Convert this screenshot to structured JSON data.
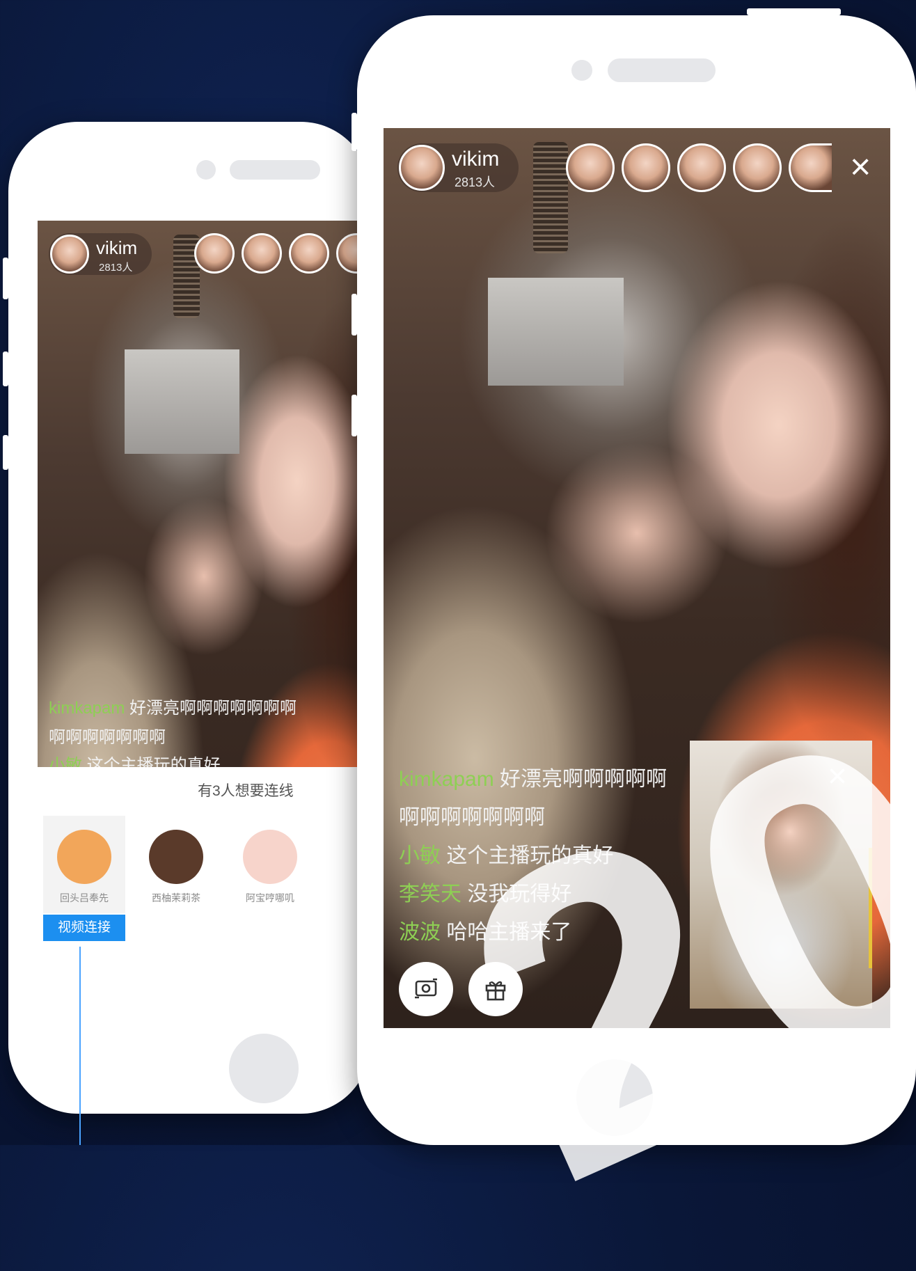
{
  "left_phone": {
    "host": {
      "name": "vikim",
      "count": "2813人"
    },
    "comments": [
      {
        "user": "kimkapam",
        "text": "好漂亮啊啊啊啊啊啊啊"
      },
      {
        "user": "",
        "text": "啊啊啊啊啊啊啊"
      },
      {
        "user": "小敏",
        "text": "这个主播玩的真好"
      }
    ],
    "connect_panel": {
      "title": "有3人想要连线",
      "candidates": [
        {
          "name": "回头吕奉先",
          "color": "#f2a65a"
        },
        {
          "name": "西柚茉莉茶",
          "color": "#5a3a2a"
        },
        {
          "name": "阿宝哼哪叽",
          "color": "#f7d4cb"
        }
      ],
      "connect_button": "视频连接"
    }
  },
  "right_phone": {
    "host": {
      "name": "vikim",
      "count": "2813人"
    },
    "close_label": "×",
    "comments": [
      {
        "user": "kimkapam",
        "text": "好漂亮啊啊啊啊啊"
      },
      {
        "user": "",
        "text": "啊啊啊啊啊啊啊"
      },
      {
        "user": "小敏",
        "text": "这个主播玩的真好"
      },
      {
        "user": "李笑天",
        "text": "没我玩得好"
      },
      {
        "user": "波波",
        "text": "哈哈主播来了"
      }
    ],
    "pip_close_label": "×",
    "controls": {
      "switch_camera_icon": "camera-switch-icon",
      "gift_icon": "gift-icon"
    }
  },
  "colors": {
    "username_green": "#8ecf54",
    "connect_blue": "#1c8ff0"
  },
  "watermark": "20"
}
